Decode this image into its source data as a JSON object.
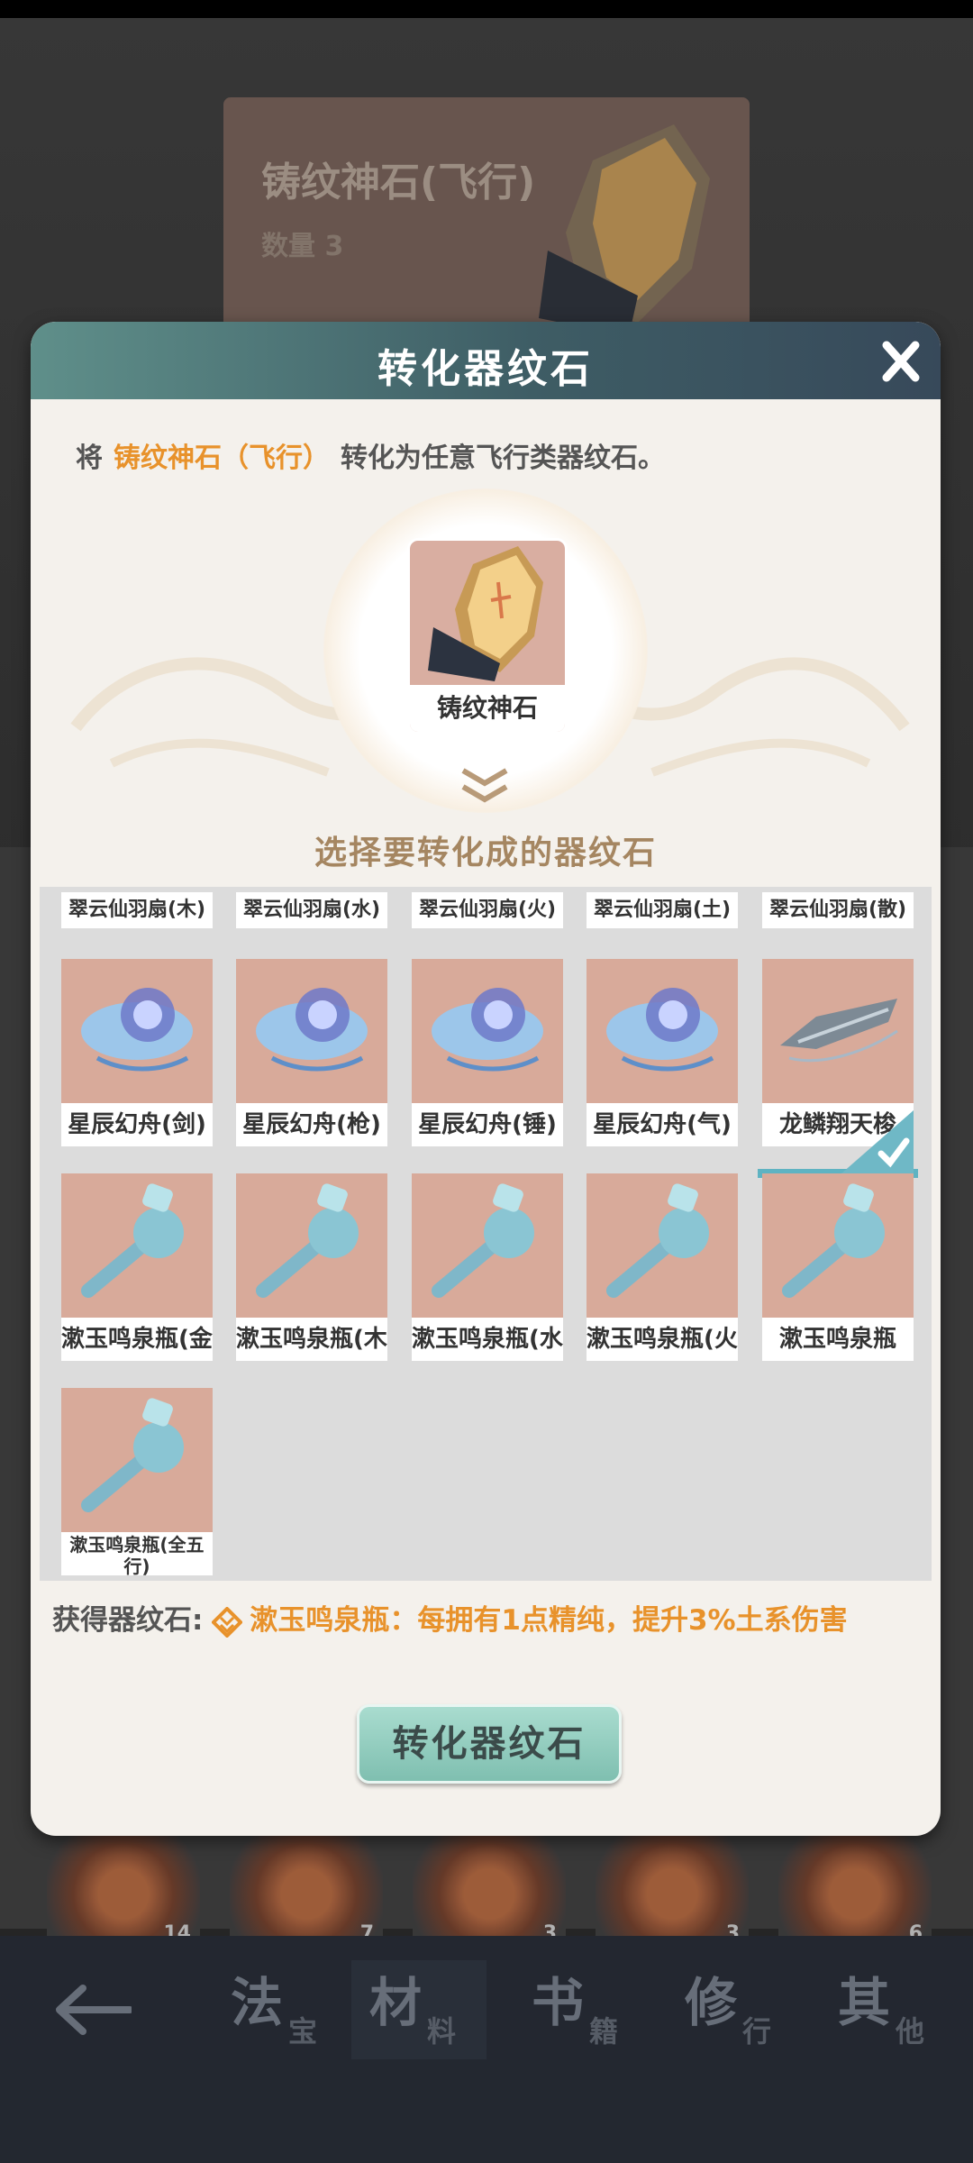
{
  "background": {
    "card_title": "铸纹神石(飞行)",
    "card_quantity": "数量 3",
    "slot_counts": [
      "14",
      "7",
      "3",
      "3",
      "6"
    ]
  },
  "bottom_nav": {
    "tabs": [
      {
        "main": "法",
        "sub": "宝"
      },
      {
        "main": "材",
        "sub": "料"
      },
      {
        "main": "书",
        "sub": "籍"
      },
      {
        "main": "修",
        "sub": "行"
      },
      {
        "main": "其",
        "sub": "他"
      }
    ],
    "active_index": 1
  },
  "dialog": {
    "title": "转化器纹石",
    "close_label": "X",
    "desc_prefix": "将",
    "desc_item": "铸纹神石（飞行）",
    "desc_suffix": "转化为任意飞行类器纹石。",
    "source_item_label": "铸纹神石",
    "select_title": "选择要转化成的器纹石",
    "top_row": [
      "翠云仙羽扇(木)",
      "翠云仙羽扇(水)",
      "翠云仙羽扇(火)",
      "翠云仙羽扇(土)",
      "翠云仙羽扇(散)"
    ],
    "row2": [
      "星辰幻舟(剑)",
      "星辰幻舟(枪)",
      "星辰幻舟(锤)",
      "星辰幻舟(气)",
      "龙鳞翔天梭"
    ],
    "row3": [
      "漱玉鸣泉瓶(金)",
      "漱玉鸣泉瓶(木)",
      "漱玉鸣泉瓶(水)",
      "漱玉鸣泉瓶(火)",
      "漱玉鸣泉瓶"
    ],
    "row4": [
      "漱玉鸣泉瓶(全五行)"
    ],
    "selected": "漱玉鸣泉瓶",
    "obtain_label": "获得器纹石:",
    "obtain_text": "漱玉鸣泉瓶：每拥有1点精纯，提升3%土系伤害",
    "convert_button": "转化器纹石"
  },
  "colors": {
    "accent_orange": "#e8922b",
    "header_teal": "#3e5d65",
    "button_mint": "#8fcbbd",
    "selection_blue": "#5fb3c2"
  }
}
